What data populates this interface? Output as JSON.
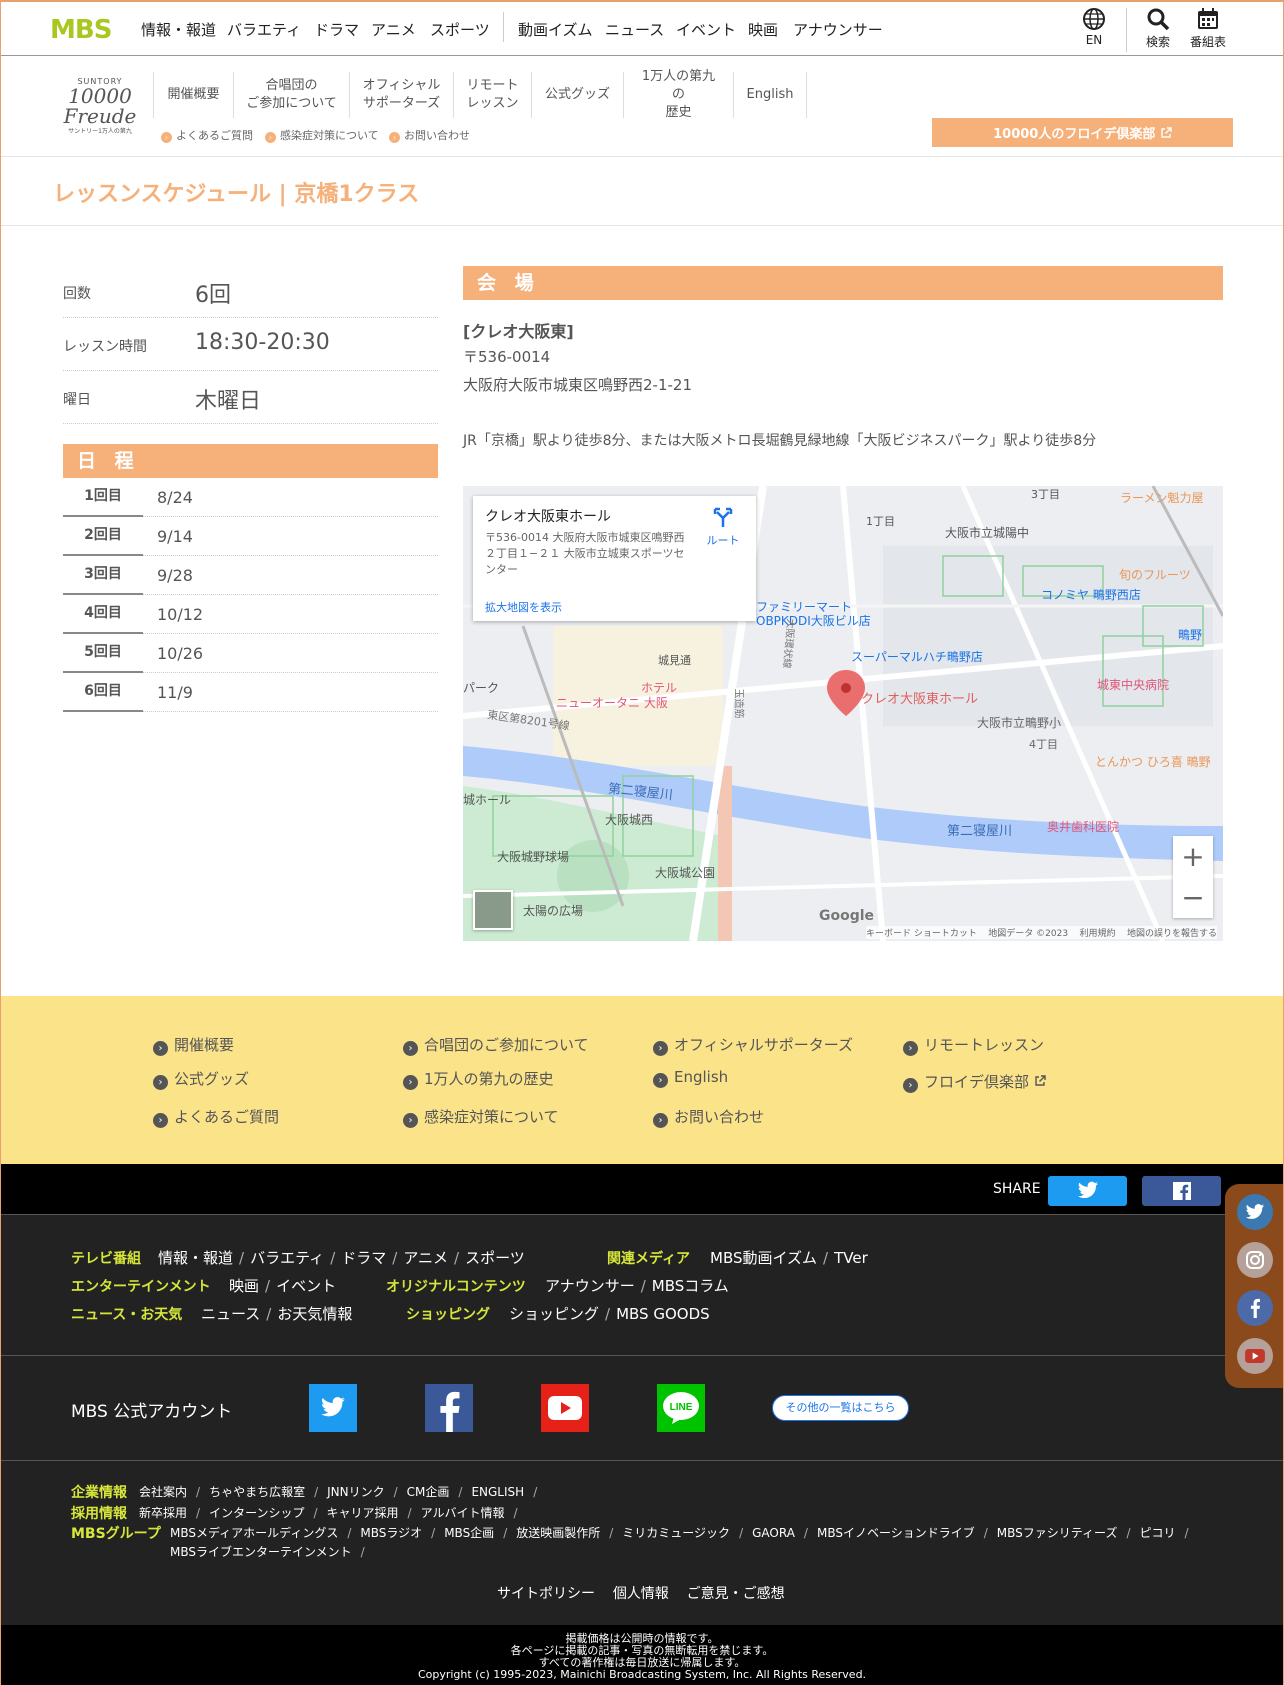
{
  "topbar": {
    "logo": "MBS",
    "nav_left": [
      "情報・報道",
      "バラエティ",
      "ドラマ",
      "アニメ",
      "スポーツ"
    ],
    "nav_right": [
      "動画イズム",
      "ニュース",
      "イベント",
      "映画",
      "アナウンサー"
    ],
    "lang_label": "EN",
    "search_label": "検索",
    "tv_label": "番組表"
  },
  "subheader": {
    "brand_top": "SUNTORY",
    "brand_main": "10000 Freude",
    "brand_sub": "サントリー1万人の第九",
    "nav": [
      "開催概要",
      "合唱団の\nご参加について",
      "オフィシャル\nサポーターズ",
      "リモート\nレッスン",
      "公式グッズ",
      "1万人の第九の\n歴史",
      "English"
    ],
    "links": [
      "よくあるご質問",
      "感染症対策について",
      "お問い合わせ"
    ],
    "club_button": "10000人のフロイデ倶楽部"
  },
  "page_title": "レッスンスケジュール | 京橋1クラス",
  "info": [
    {
      "label": "回数",
      "value": "6回"
    },
    {
      "label": "レッスン時間",
      "value": "18:30-20:30"
    },
    {
      "label": "曜日",
      "value": "木曜日"
    }
  ],
  "schedule": {
    "heading": "日 程",
    "rows": [
      {
        "label": "1回目",
        "date": "8/24"
      },
      {
        "label": "2回目",
        "date": "9/14"
      },
      {
        "label": "3回目",
        "date": "9/28"
      },
      {
        "label": "4回目",
        "date": "10/12"
      },
      {
        "label": "5回目",
        "date": "10/26"
      },
      {
        "label": "6回目",
        "date": "11/9"
      }
    ]
  },
  "venue": {
    "heading": "会 場",
    "name": "[クレオ大阪東]",
    "postal": "〒536-0014",
    "address": "大阪府大阪市城東区鳴野西2-1-21",
    "access": "JR「京橋」駅より徒歩8分、または大阪メトロ長堀鶴見緑地線「大阪ビジネスパーク」駅より徒歩8分"
  },
  "map": {
    "card_title": "クレオ大阪東ホール",
    "card_address": "〒536-0014 大阪府大阪市城東区鳴野西２丁目１−２１ 大阪市立城東スポーツセンター",
    "card_link": "拡大地図を表示",
    "route_label": "ルート",
    "labels": [
      "3丁目",
      "ラーメン魁力屋",
      "1丁目",
      "大阪市立城陽中",
      "旬のフルーツ",
      "ファミリーマート",
      "OBPKDDI大阪ビル店",
      "コノミヤ 鴫野西店",
      "鴫野",
      "スーパーマルハチ鴫野店",
      "城見通",
      "ホテル",
      "ニューオータニ 大阪",
      "クレオ大阪東ホール",
      "城東中央病院",
      "大阪市立鴫野小",
      "4丁目",
      "パーク",
      "東区第8201号線",
      "とんかつ ひろ喜 鴫野",
      "第二寝屋川",
      "城ホール",
      "大阪城西",
      "奥井歯科医院",
      "第二寝屋川",
      "大阪城野球場",
      "大阪城公園",
      "太陽の広場",
      "大阪環状線",
      "玉造筋"
    ],
    "footer": [
      "キーボード ショートカット",
      "地図データ ©2023",
      "利用規約",
      "地図の誤りを報告する"
    ],
    "google": "Google"
  },
  "yellow_footer": {
    "links": [
      "開催概要",
      "合唱団のご参加について",
      "オフィシャルサポーターズ",
      "リモートレッスン",
      "公式グッズ",
      "1万人の第九の歴史",
      "English",
      "フロイデ倶楽部",
      "よくあるご質問",
      "感染症対策について",
      "お問い合わせ"
    ]
  },
  "share": {
    "label": "SHARE"
  },
  "dark_footer": {
    "tv_cat": "テレビ番組",
    "tv_links": [
      "情報・報道",
      "バラエティ",
      "ドラマ",
      "アニメ",
      "スポーツ"
    ],
    "media_cat": "関連メディア",
    "media_links": [
      "MBS動画イズム",
      "TVer"
    ],
    "ent_cat": "エンターテインメント",
    "ent_links": [
      "映画",
      "イベント"
    ],
    "orig_cat": "オリジナルコンテンツ",
    "orig_links": [
      "アナウンサー",
      "MBSコラム"
    ],
    "news_cat": "ニュース・お天気",
    "news_links": [
      "ニュース",
      "お天気情報"
    ],
    "shop_cat": "ショッピング",
    "shop_links": [
      "ショッピング",
      "MBS GOODS"
    ],
    "official_label": "MBS 公式アカウント",
    "others_button": "その他の一覧はこちら",
    "corp_cat": "企業情報",
    "corp_links": [
      "会社案内",
      "ちゃやまち広報室",
      "JNNリンク",
      "CM企画",
      "ENGLISH"
    ],
    "recruit_cat": "採用情報",
    "recruit_links": [
      "新卒採用",
      "インターンシップ",
      "キャリア採用",
      "アルバイト情報"
    ],
    "group_cat": "MBSグループ",
    "group_links": [
      "MBSメディアホールディングス",
      "MBSラジオ",
      "MBS企画",
      "放送映画製作所",
      "ミリカミュージック",
      "GAORA",
      "MBSイノベーションドライブ",
      "MBSファシリティーズ",
      "ピコリ"
    ],
    "group_links2": [
      "MBSライブエンターテインメント"
    ],
    "policy_links": [
      "サイトポリシー",
      "個人情報",
      "ご意見・ご感想"
    ]
  },
  "copyright": {
    "line1": "掲載価格は公開時の情報です。",
    "line2": "各ページに掲載の記事・写真の無断転用を禁じます。",
    "line3": "すべての著作権は毎日放送に帰属します。",
    "line4": "Copyright (c) 1995-2023, Mainichi Broadcasting System, Inc. All Rights Reserved."
  },
  "colors": {
    "accent": "#f6b07a",
    "brand_green": "#a8c820",
    "footer_yellow": "#fbe38a",
    "category_yellow": "#d7e63a"
  }
}
